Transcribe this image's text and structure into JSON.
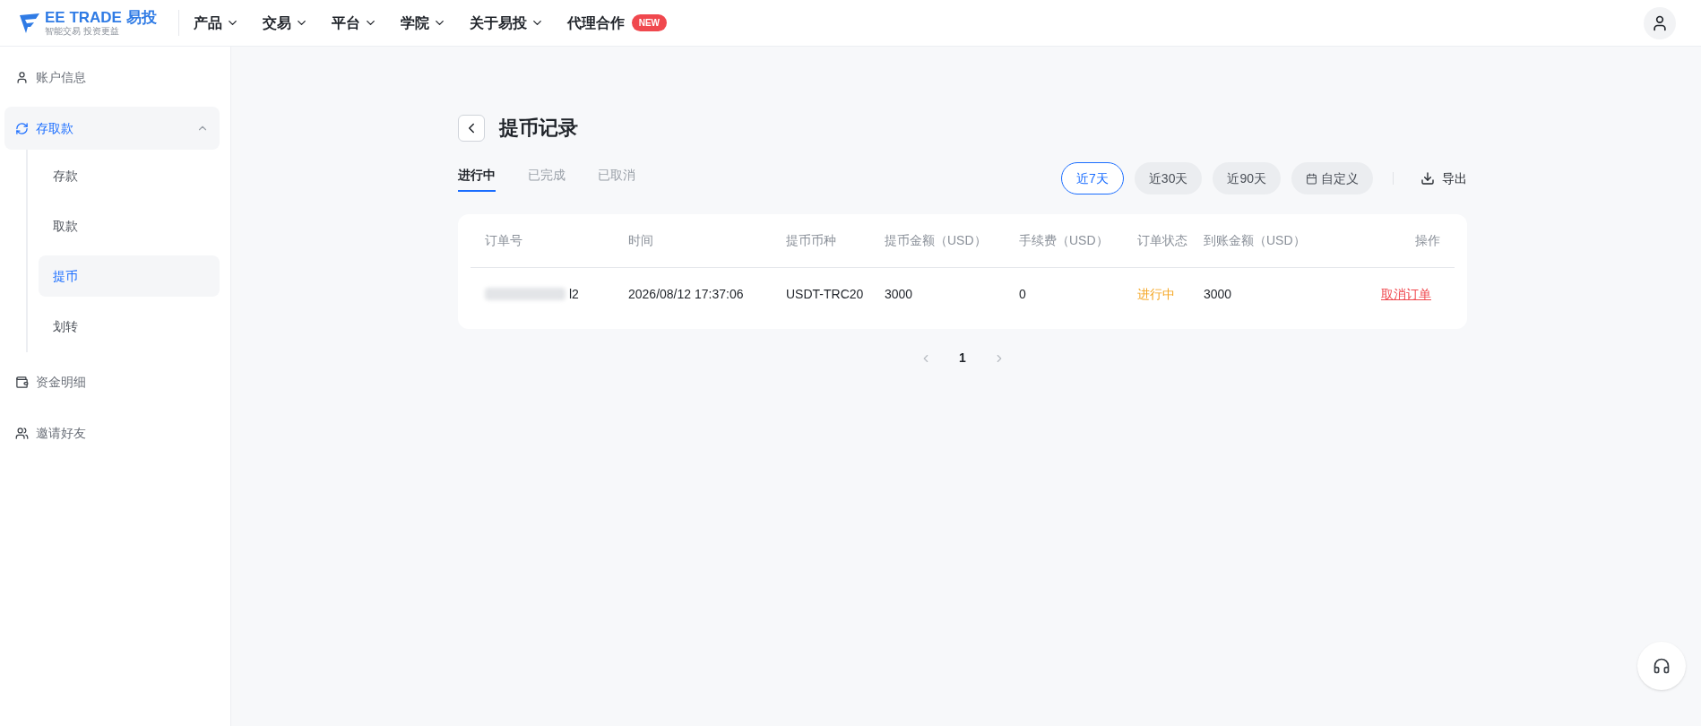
{
  "header": {
    "logo_title": "EE TRADE 易投",
    "logo_slogan": "智能交易 投资更益",
    "nav": [
      {
        "label": "产品",
        "dropdown": true
      },
      {
        "label": "交易",
        "dropdown": true
      },
      {
        "label": "平台",
        "dropdown": true
      },
      {
        "label": "学院",
        "dropdown": true
      },
      {
        "label": "关于易投",
        "dropdown": true
      },
      {
        "label": "代理合作",
        "dropdown": false,
        "badge": "NEW"
      }
    ]
  },
  "sidebar": {
    "items": [
      {
        "label": "账户信息",
        "kind": "user",
        "selected": false
      },
      {
        "label": "存取款",
        "kind": "exchange",
        "selected": true,
        "expanded": true,
        "children": [
          {
            "label": "存款",
            "selected": false
          },
          {
            "label": "取款",
            "selected": false
          },
          {
            "label": "提币",
            "selected": true
          },
          {
            "label": "划转",
            "selected": false
          }
        ]
      },
      {
        "label": "资金明细",
        "kind": "wallet",
        "selected": false
      },
      {
        "label": "邀请好友",
        "kind": "users",
        "selected": false
      }
    ]
  },
  "page": {
    "title": "提币记录",
    "tabs": [
      {
        "label": "进行中",
        "selected": true
      },
      {
        "label": "已完成",
        "selected": false
      },
      {
        "label": "已取消",
        "selected": false
      }
    ],
    "ranges": [
      {
        "label": "近7天",
        "selected": true,
        "kind": "preset"
      },
      {
        "label": "近30天",
        "selected": false,
        "kind": "preset"
      },
      {
        "label": "近90天",
        "selected": false,
        "kind": "preset"
      },
      {
        "label": "自定义",
        "selected": false,
        "kind": "custom"
      }
    ],
    "export": "导出",
    "table": {
      "columns": [
        "订单号",
        "时间",
        "提币币种",
        "提币金额（USD）",
        "手续费（USD）",
        "订单状态",
        "到账金额（USD）",
        "操作"
      ],
      "rows": [
        {
          "order": "l2",
          "time": "2026/08/12 17:37:06",
          "coin": "USDT-TRC20",
          "amount": "3000",
          "fee": "0",
          "status": "进行中",
          "received": "3000",
          "action": "取消订单"
        }
      ]
    },
    "pagination": {
      "pages": [
        {
          "label": "1",
          "selected": true
        }
      ]
    }
  }
}
